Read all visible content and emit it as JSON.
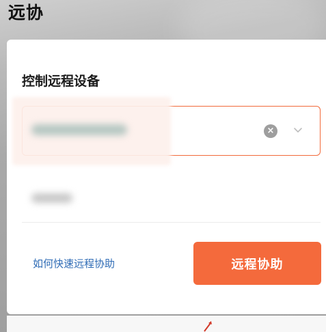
{
  "header": {
    "title": "远协"
  },
  "card": {
    "section_title": "控制远程设备",
    "device_select": {
      "clear_icon": "clear-circle-icon",
      "dropdown_icon": "chevron-down-icon",
      "accent_color": "#f26a3a"
    },
    "help_link": "如何快速远程协助",
    "assist_button": "远程协助"
  },
  "colors": {
    "accent": "#f46a3c",
    "link": "#2e6bb5"
  }
}
